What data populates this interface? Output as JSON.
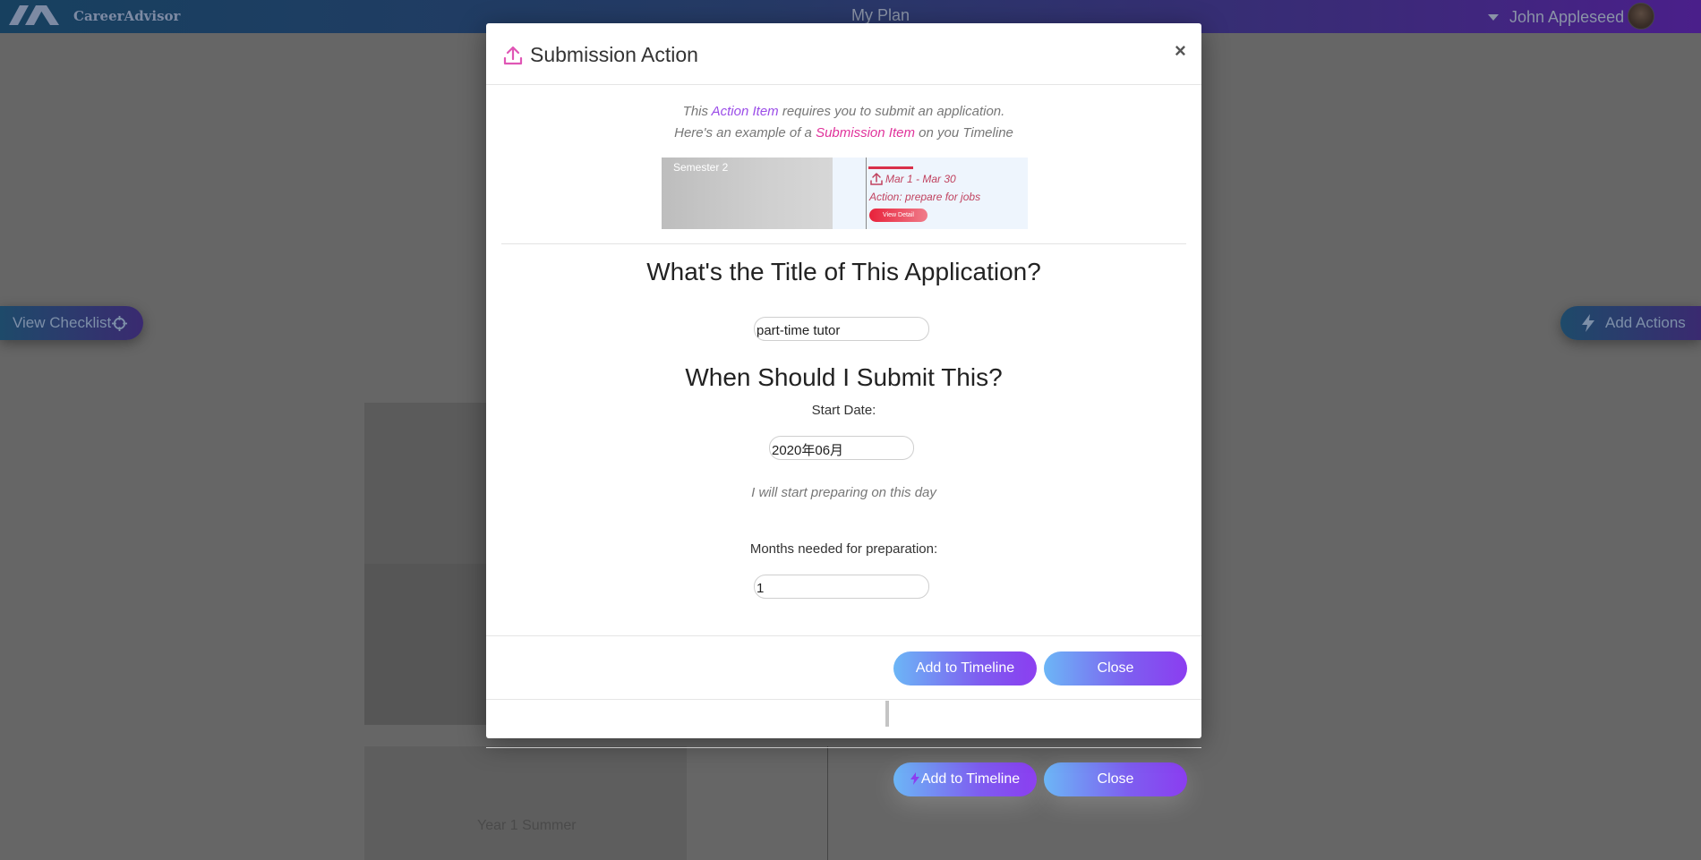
{
  "app": {
    "brand": "CareerAdvisor",
    "page_title": "My Plan",
    "user_name": "John Appleseed"
  },
  "side_buttons": {
    "view_checklist": "View Checklist",
    "add_actions": "Add Actions"
  },
  "background": {
    "year_label": "Year 1 Summer",
    "add_to_timeline": "Add to Timeline",
    "close": "Close"
  },
  "modal": {
    "title": "Submission Action",
    "close_symbol": "×",
    "intro": {
      "line1_prefix": "This ",
      "line1_highlight": "Action Item",
      "line1_suffix": " requires you to submit an application.",
      "line2_prefix": "Here's an example of a ",
      "line2_highlight": "Submission Item",
      "line2_suffix": " on you Timeline"
    },
    "example": {
      "semester": "Semester 2",
      "date_range": "Mar 1 - Mar 30",
      "action": "Action: prepare for jobs",
      "view_detail": "View Detail"
    },
    "title_question": "What's the Title of This Application?",
    "title_value": "part-time tutor",
    "when_question": "When Should I Submit This?",
    "start_date_label": "Start Date:",
    "start_date_value": "2020年06月",
    "start_hint": "I will start preparing on this day",
    "months_label": "Months needed for preparation:",
    "months_value": "1",
    "add_to_timeline": "Add to Timeline",
    "close": "Close"
  },
  "colors": {
    "accent_purple": "#9b4de8",
    "accent_magenta": "#e0339b",
    "button_gradient_start": "#6cb6f6",
    "button_gradient_end": "#8b3df0"
  }
}
